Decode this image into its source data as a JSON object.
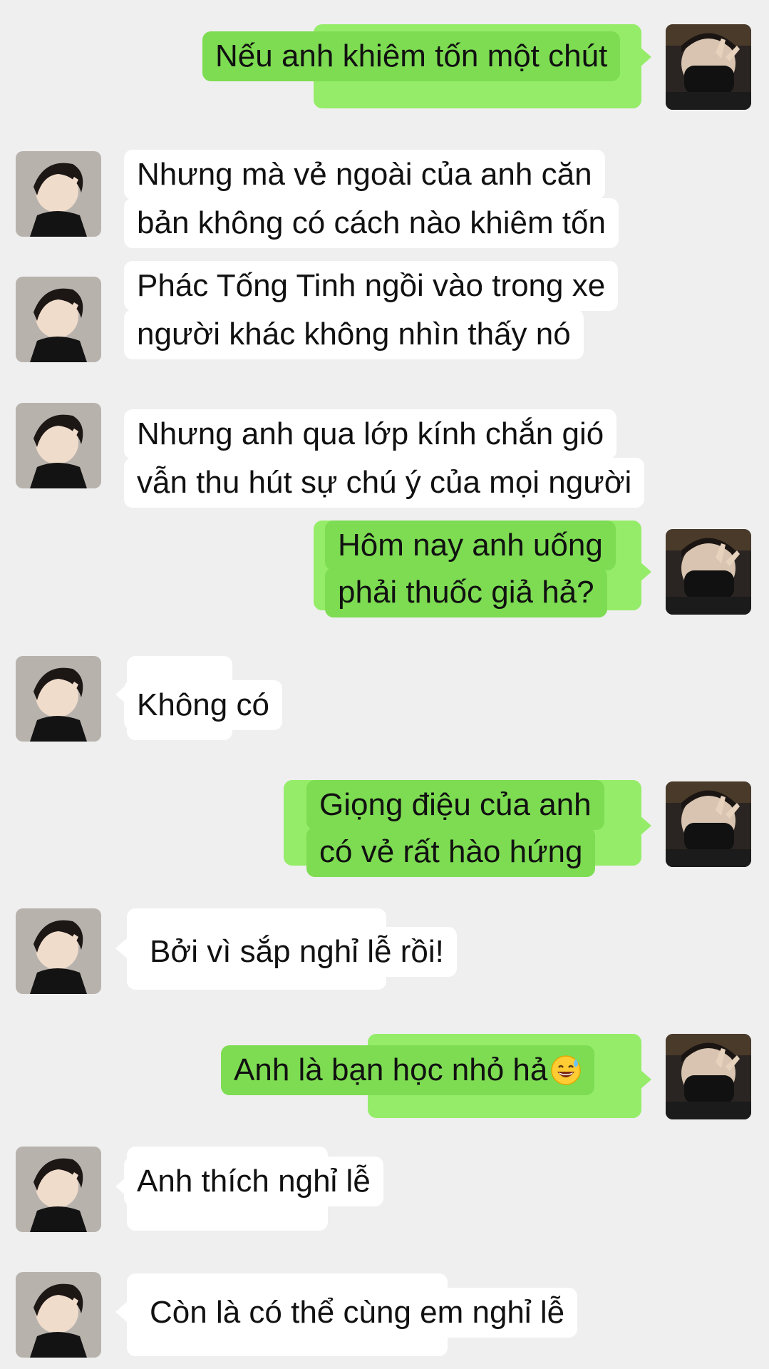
{
  "messages": [
    {
      "sender": "me",
      "lines": [
        "Nếu anh khiêm tốn một chút"
      ]
    },
    {
      "sender": "other",
      "lines": [
        "Nhưng mà vẻ ngoài của anh căn",
        "bản không có cách nào khiêm tốn"
      ]
    },
    {
      "sender": "other",
      "lines": [
        "Phác Tống Tinh ngồi vào trong xe",
        "người khác không nhìn thấy nó"
      ]
    },
    {
      "sender": "other",
      "lines": [
        "Nhưng anh qua lớp kính chắn gió",
        "vẫn thu hút sự chú ý của mọi người"
      ]
    },
    {
      "sender": "me",
      "lines": [
        "Hôm nay anh uống",
        "phải thuốc giả hả?"
      ]
    },
    {
      "sender": "other",
      "lines": [
        "Không có"
      ]
    },
    {
      "sender": "me",
      "lines": [
        "Giọng điệu của anh",
        "có vẻ rất hào hứng"
      ]
    },
    {
      "sender": "other",
      "lines": [
        "Bởi vì sắp nghỉ lễ rồi!"
      ]
    },
    {
      "sender": "me",
      "lines": [
        "Anh là bạn học nhỏ hả"
      ],
      "emoji": "grinning-sweat-emoji"
    },
    {
      "sender": "other",
      "lines": [
        "Anh thích nghỉ lễ"
      ]
    },
    {
      "sender": "other",
      "lines": [
        "Còn là có thể cùng em nghỉ lễ"
      ]
    }
  ],
  "colors": {
    "background": "#efefef",
    "my_bubble": "#95ec69",
    "my_bubble_highlight": "#7ddc52",
    "other_bubble": "#ffffff",
    "text": "#111111"
  }
}
